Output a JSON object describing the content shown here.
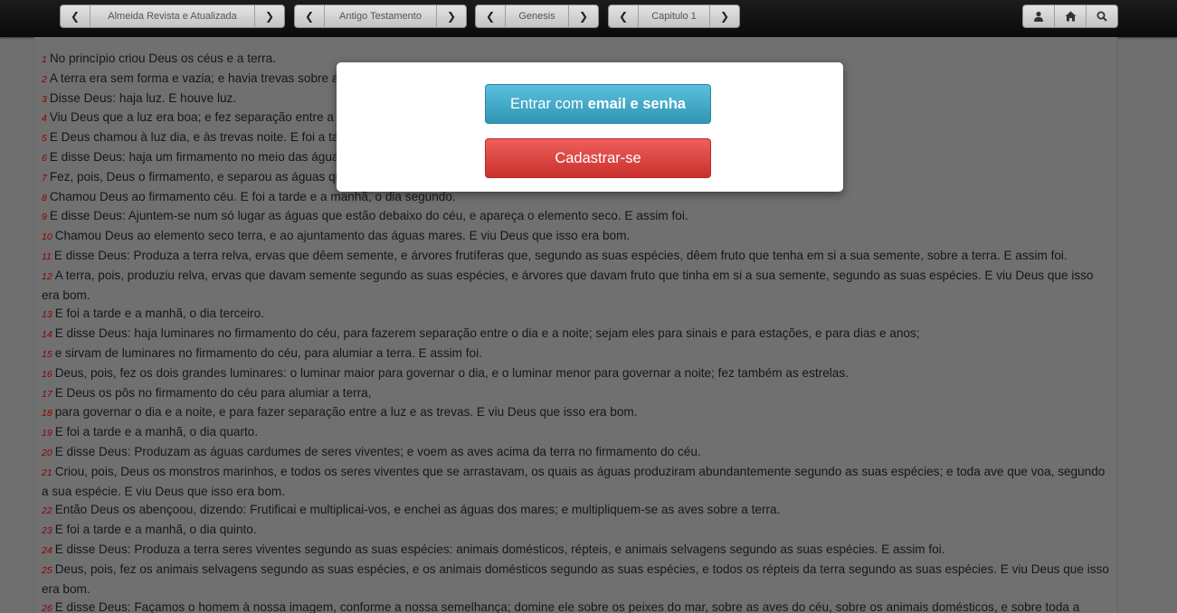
{
  "navbar": {
    "version_label": "Almeida Revista e Atualizada",
    "testament_label": "Antigo Testamento",
    "book_label": "Genesis",
    "chapter_label": "Capitulo 1",
    "icons": [
      "user-icon",
      "home-icon",
      "search-icon"
    ]
  },
  "modal": {
    "login_prefix": "Entrar com",
    "login_bold": "email e senha",
    "signup_label": "Cadastrar-se"
  },
  "colors": {
    "login_button": "#31a0c6",
    "signup_button": "#d9302f",
    "verse_number": "#8a0000"
  },
  "verses": [
    {
      "n": "1",
      "t": "No princípio criou Deus os céus e a terra."
    },
    {
      "n": "2",
      "t": "A terra era sem forma e vazia; e havia trevas sobre a face do abismo, mas o Espírito de Deus pairava sobre a face das águas."
    },
    {
      "n": "3",
      "t": "Disse Deus: haja luz. E houve luz."
    },
    {
      "n": "4",
      "t": "Viu Deus que a luz era boa; e fez separação entre a luz e as trevas."
    },
    {
      "n": "5",
      "t": "E Deus chamou à luz dia, e às trevas noite. E foi a tarde e a manhã, o dia primeiro."
    },
    {
      "n": "6",
      "t": "E disse Deus: haja um firmamento no meio das águas, e haja separação entre águas e águas."
    },
    {
      "n": "7",
      "t": "Fez, pois, Deus o firmamento, e separou as águas que estavam debaixo do firmamento das que estavam por cima do firmamento. E assim foi."
    },
    {
      "n": "8",
      "t": "Chamou Deus ao firmamento céu. E foi a tarde e a manhã, o dia segundo."
    },
    {
      "n": "9",
      "t": "E disse Deus: Ajuntem-se num só lugar as águas que estão debaixo do céu, e apareça o elemento seco. E assim foi."
    },
    {
      "n": "10",
      "t": "Chamou Deus ao elemento seco terra, e ao ajuntamento das águas mares. E viu Deus que isso era bom."
    },
    {
      "n": "11",
      "t": "E disse Deus: Produza a terra relva, ervas que dêem semente, e árvores frutíferas que, segundo as suas espécies, dêem fruto que tenha em si a sua semente, sobre a terra. E assim foi."
    },
    {
      "n": "12",
      "t": "A terra, pois, produziu relva, ervas que davam semente segundo as suas espécies, e árvores que davam fruto que tinha em si a sua semente, segundo as suas espécies. E viu Deus que isso era bom."
    },
    {
      "n": "13",
      "t": "E foi a tarde e a manhã, o dia terceiro."
    },
    {
      "n": "14",
      "t": "E disse Deus: haja luminares no firmamento do céu, para fazerem separação entre o dia e a noite; sejam eles para sinais e para estações, e para dias e anos;"
    },
    {
      "n": "15",
      "t": "e sirvam de luminares no firmamento do céu, para alumiar a terra. E assim foi."
    },
    {
      "n": "16",
      "t": "Deus, pois, fez os dois grandes luminares: o luminar maior para governar o dia, e o luminar menor para governar a noite; fez também as estrelas."
    },
    {
      "n": "17",
      "t": "E Deus os pôs no firmamento do céu para alumiar a terra,"
    },
    {
      "n": "18",
      "t": "para governar o dia e a noite, e para fazer separação entre a luz e as trevas. E viu Deus que isso era bom."
    },
    {
      "n": "19",
      "t": "E foi a tarde e a manhã, o dia quarto."
    },
    {
      "n": "20",
      "t": "E disse Deus: Produzam as águas cardumes de seres viventes; e voem as aves acima da terra no firmamento do céu."
    },
    {
      "n": "21",
      "t": "Criou, pois, Deus os monstros marinhos, e todos os seres viventes que se arrastavam, os quais as águas produziram abundantemente segundo as suas espécies; e toda ave que voa, segundo a sua espécie. E viu Deus que isso era bom."
    },
    {
      "n": "22",
      "t": "Então Deus os abençoou, dizendo: Frutificai e multiplicai-vos, e enchei as águas dos mares; e multipliquem-se as aves sobre a terra."
    },
    {
      "n": "23",
      "t": "E foi a tarde e a manhã, o dia quinto."
    },
    {
      "n": "24",
      "t": "E disse Deus: Produza a terra seres viventes segundo as suas espécies: animais domésticos, répteis, e animais selvagens segundo as suas espécies. E assim foi."
    },
    {
      "n": "25",
      "t": "Deus, pois, fez os animais selvagens segundo as suas espécies, e os animais domésticos segundo as suas espécies, e todos os répteis da terra segundo as suas espécies. E viu Deus que isso era bom."
    },
    {
      "n": "26",
      "t": "E disse Deus: Façamos o homem à nossa imagem, conforme a nossa semelhança; domine ele sobre os peixes do mar, sobre as aves do céu, sobre os animais domésticos, e sobre toda a terra, e sobre todo réptil que se arrasta sobre a terra."
    }
  ]
}
